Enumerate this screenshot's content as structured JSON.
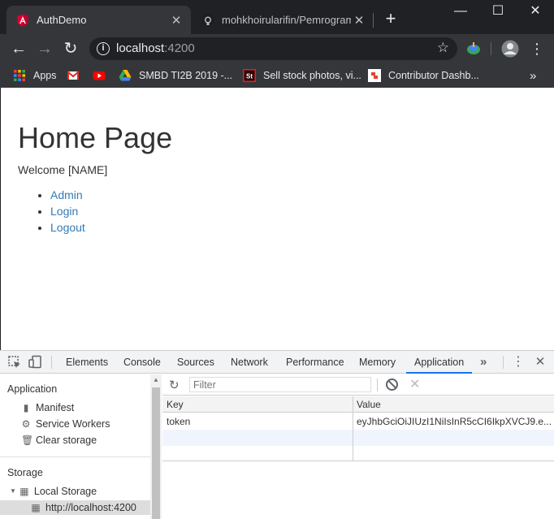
{
  "browser": {
    "tabs": [
      {
        "title": "AuthDemo",
        "icon": "angular-icon",
        "active": true
      },
      {
        "title": "mohkhoirularifin/Pemrograma",
        "icon": "github-icon",
        "active": false
      }
    ],
    "address": {
      "host": "localhost",
      "port": ":4200"
    },
    "bookmarks": [
      {
        "label": "Apps",
        "icon": "apps-grid-icon"
      },
      {
        "label": "",
        "icon": "gmail-icon"
      },
      {
        "label": "",
        "icon": "youtube-icon"
      },
      {
        "label": "SMBD TI2B 2019 -...",
        "icon": "google-drive-icon"
      },
      {
        "label": "Sell stock photos, vi...",
        "icon": "stock-icon"
      },
      {
        "label": "Contributor Dashb...",
        "icon": "contributor-icon"
      }
    ]
  },
  "page": {
    "heading": "Home Page",
    "welcome": "Welcome [NAME]",
    "links": [
      "Admin",
      "Login",
      "Logout"
    ]
  },
  "devtools": {
    "tabs": [
      "Elements",
      "Console",
      "Sources",
      "Network",
      "Performance",
      "Memory",
      "Application"
    ],
    "more": "»",
    "sidebar": {
      "application_header": "Application",
      "application_items": [
        "Manifest",
        "Service Workers",
        "Clear storage"
      ],
      "storage_header": "Storage",
      "local_storage": "Local Storage",
      "origin": "http://localhost:4200"
    },
    "filter_placeholder": "Filter",
    "table": {
      "columns": [
        "Key",
        "Value"
      ],
      "rows": [
        {
          "key": "token",
          "value": "eyJhbGciOiJIUzI1NiIsInR5cCI6IkpXVCJ9.e..."
        }
      ]
    }
  },
  "colors": {
    "chrome_dark": "#202124",
    "chrome_toolbar": "#35363a",
    "link": "#337ab7",
    "devtools_accent": "#1a73e8"
  }
}
